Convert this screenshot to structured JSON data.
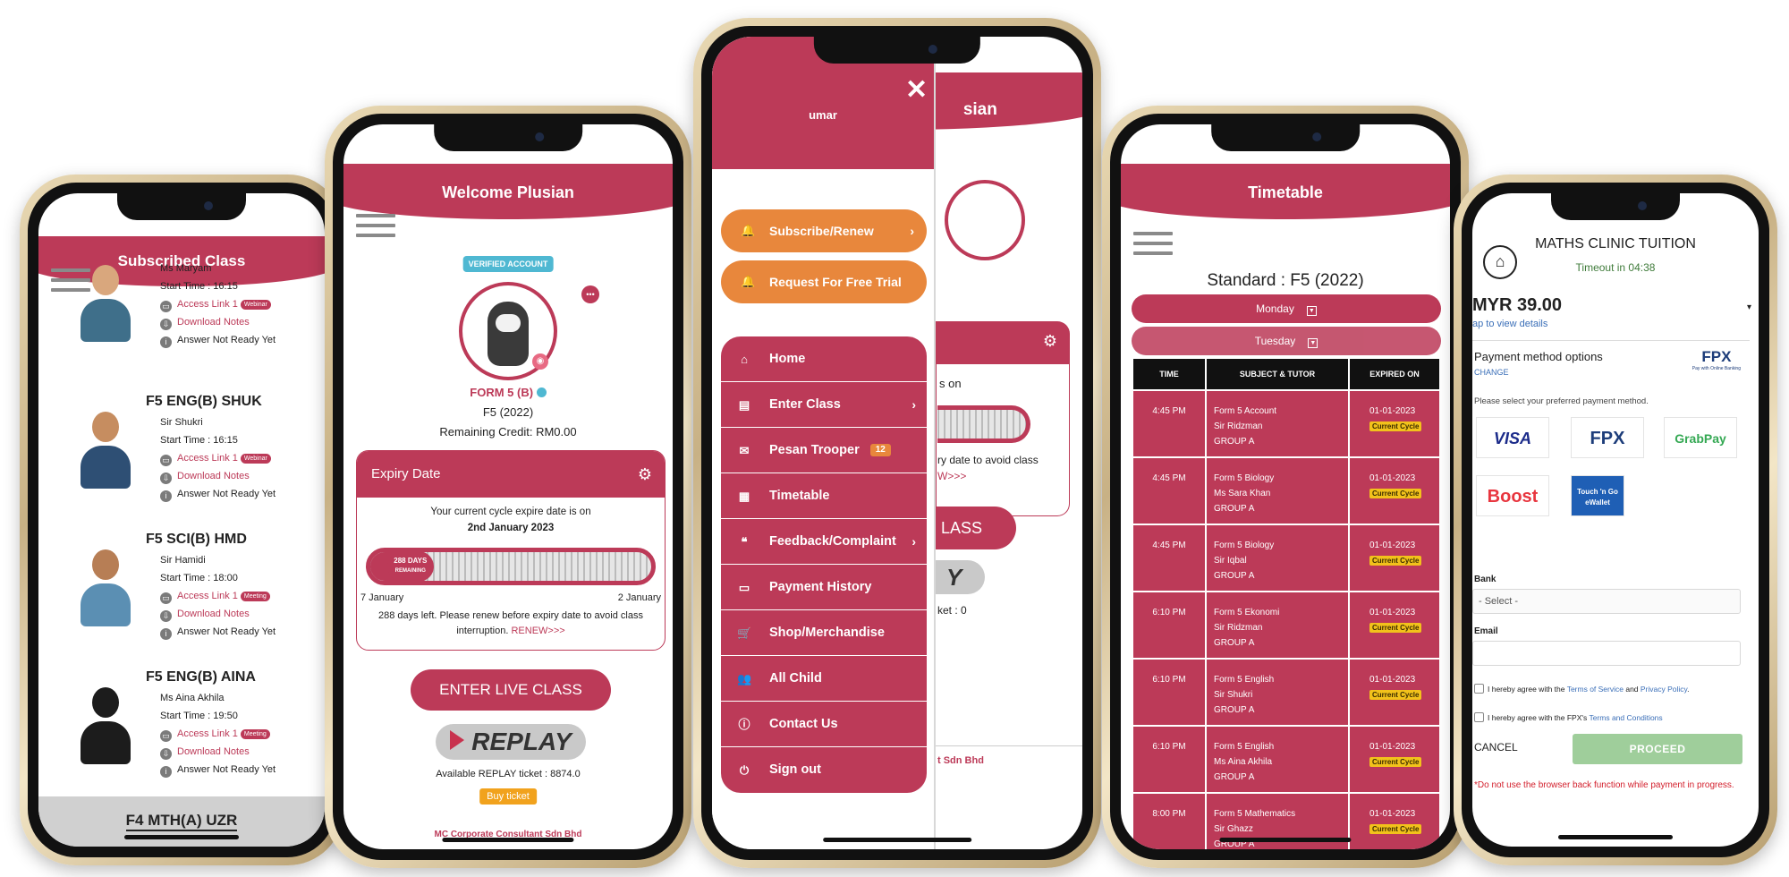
{
  "phone1": {
    "header": "Subscribed Class",
    "top_entry": {
      "tutor": "Ms Maryam",
      "start": "Start Time : 16:15",
      "access": "Access Link 1",
      "tag": "Webinar",
      "download": "Download Notes",
      "answer": "Answer Not Ready Yet"
    },
    "classes": [
      {
        "title": "F5 ENG(B) SHUK",
        "tutor": "Sir Shukri",
        "start": "Start Time : 16:15",
        "access": "Access Link 1",
        "tag": "Webinar",
        "download": "Download Notes",
        "answer": "Answer Not Ready Yet"
      },
      {
        "title": "F5 SCI(B) HMD",
        "tutor": "Sir Hamidi",
        "start": "Start Time : 18:00",
        "access": "Access Link 1",
        "tag": "Meeting",
        "download": "Download Notes",
        "answer": "Answer Not Ready Yet"
      },
      {
        "title": "F5 ENG(B) AINA",
        "tutor": "Ms Aina Akhila",
        "start": "Start Time : 19:50",
        "access": "Access Link 1",
        "tag": "Meeting",
        "download": "Download Notes",
        "answer": "Answer Not Ready Yet"
      }
    ],
    "footer_class": "F4 MTH(A) UZR"
  },
  "phone2": {
    "header": "Welcome Plusian",
    "verified": "VERIFIED ACCOUNT",
    "form": "FORM 5 (B)",
    "year": "F5 (2022)",
    "credit": "Remaining Credit: RM0.00",
    "expiry_title": "Expiry Date",
    "cycle_text": "Your current cycle expire date is on",
    "cycle_date": "2nd January 2023",
    "days_label": "288 DAYS",
    "remaining_label": "REMAINING",
    "days_remaining_fraction": 0.2,
    "range_start": "7 January",
    "range_end": "2 January",
    "renew_text": "288 days left. Please renew before expiry date to avoid class interruption.",
    "renew_link": "RENEW>>>",
    "live_button": "ENTER LIVE CLASS",
    "replay": "REPLAY",
    "ticket": "Available REPLAY ticket : 8874.0",
    "buy": "Buy ticket",
    "footer": "MC Corporate Consultant Sdn Bhd"
  },
  "phone3": {
    "user": "umar",
    "under_header": "sian",
    "under_fragment1": "s on",
    "under_fragment2": "ry date to avoid class",
    "under_fragment3": "W>>>",
    "under_fragment4": "LASS",
    "under_fragment5": "Y",
    "under_fragment6": "ket : 0",
    "under_footer": "t Sdn Bhd",
    "subscribe": "Subscribe/Renew",
    "trial": "Request For Free Trial",
    "menu": [
      {
        "label": "Home",
        "icon": "home-icon",
        "glyph": "⌂"
      },
      {
        "label": "Enter Class",
        "icon": "book-icon",
        "glyph": "▤",
        "chev": "›"
      },
      {
        "label": "Pesan Trooper",
        "icon": "envelope-icon",
        "glyph": "✉",
        "count": "12"
      },
      {
        "label": "Timetable",
        "icon": "calendar-icon",
        "glyph": "▦"
      },
      {
        "label": "Feedback/Complaint",
        "icon": "comments-icon",
        "glyph": "❝",
        "chev": "›"
      },
      {
        "label": "Payment History",
        "icon": "money-icon",
        "glyph": "▭"
      },
      {
        "label": "Shop/Merchandise",
        "icon": "cart-icon",
        "glyph": "🛒"
      },
      {
        "label": "All Child",
        "icon": "users-icon",
        "glyph": "👥"
      },
      {
        "label": "Contact Us",
        "icon": "info-icon",
        "glyph": "ⓘ"
      },
      {
        "label": "Sign out",
        "icon": "power-icon",
        "glyph": "⏻"
      }
    ]
  },
  "phone4": {
    "header": "Timetable",
    "standard": "Standard : F5 (2022)",
    "day1": "Monday",
    "day2": "Tuesday",
    "columns": [
      "TIME",
      "SUBJECT & TUTOR",
      "EXPIRED ON"
    ],
    "rows": [
      {
        "time": "4:45 PM",
        "subject": "Form 5 Account",
        "tutor": "Sir Ridzman",
        "group": "GROUP A",
        "expired": "01-01-2023",
        "badge": "Current Cycle"
      },
      {
        "time": "4:45 PM",
        "subject": "Form 5 Biology",
        "tutor": "Ms Sara Khan",
        "group": "GROUP A",
        "expired": "01-01-2023",
        "badge": "Current Cycle"
      },
      {
        "time": "4:45 PM",
        "subject": "Form 5 Biology",
        "tutor": "Sir Iqbal",
        "group": "GROUP A",
        "expired": "01-01-2023",
        "badge": "Current Cycle"
      },
      {
        "time": "6:10 PM",
        "subject": "Form 5 Ekonomi",
        "tutor": "Sir Ridzman",
        "group": "GROUP A",
        "expired": "01-01-2023",
        "badge": "Current Cycle"
      },
      {
        "time": "6:10 PM",
        "subject": "Form 5 English",
        "tutor": "Sir Shukri",
        "group": "GROUP A",
        "expired": "01-01-2023",
        "badge": "Current Cycle"
      },
      {
        "time": "6:10 PM",
        "subject": "Form 5 English",
        "tutor": "Ms Aina Akhila",
        "group": "GROUP A",
        "expired": "01-01-2023",
        "badge": "Current Cycle"
      },
      {
        "time": "8:00 PM",
        "subject": "Form 5 Mathematics",
        "tutor": "Sir Ghazz",
        "group": "GROUP A",
        "expired": "01-01-2023",
        "badge": "Current Cycle"
      }
    ]
  },
  "phone5": {
    "merchant": "MATHS CLINIC TUITION",
    "timeout": "Timeout in 04:38",
    "amount": "MYR 39.00",
    "tap": "ap to view details",
    "pm_title": "Payment method options",
    "change": "CHANGE",
    "fpx_badge": "FPX",
    "fpx_sub": "Pay with Online Banking",
    "select_text": "Please select your preferred payment method.",
    "methods": [
      "VISA",
      "FPX",
      "GrabPay",
      "Boost",
      "Touch 'n Go eWallet"
    ],
    "bank_label": "Bank",
    "bank_select": "- Select -",
    "email_label": "Email",
    "agree1_pre": "I hereby agree with the ",
    "agree1_tos": "Terms of Service",
    "agree1_and": " and ",
    "agree1_pp": "Privacy Policy",
    "agree1_end": ".",
    "agree2_pre": "I hereby agree with the FPX's ",
    "agree2_tc": "Terms and Conditions",
    "cancel": "CANCEL",
    "proceed": "PROCEED",
    "warning": "*Do not use the browser back function while payment in progress.",
    "colors": {
      "accent": "#bc3a58",
      "orange": "#e8873c",
      "badge": "#f2c21b",
      "proceed": "#9fce9b"
    }
  }
}
